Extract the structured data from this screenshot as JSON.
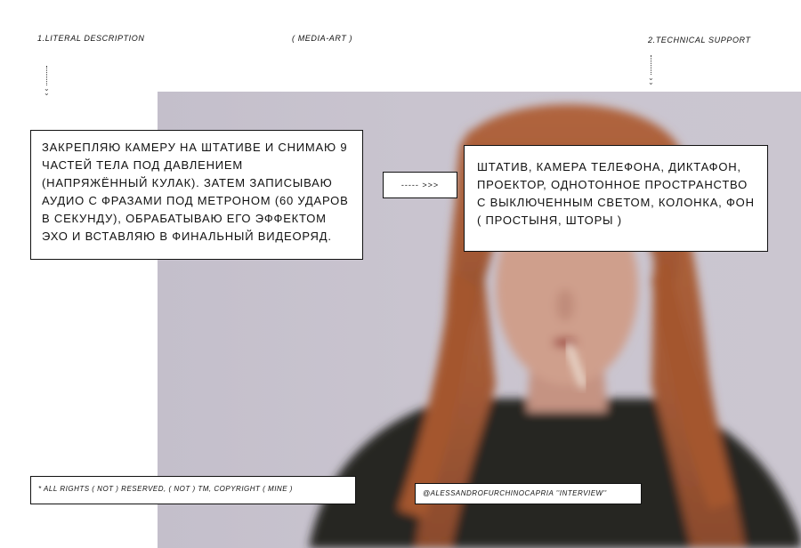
{
  "header": {
    "left_label": "1.LITERAL DESCRIPTION",
    "middle_label": "( MEDIA-ART )",
    "right_label": "2.TECHNICAL SUPPORT"
  },
  "description_box": {
    "text": "ЗАКРЕПЛЯЮ КАМЕРУ НА ШТАТИВЕ И СНИМАЮ 9 ЧАСТЕЙ ТЕЛА ПОД ДАВЛЕНИЕМ (НАПРЯЖЁННЫЙ КУЛАК). ЗАТЕМ ЗАПИСЫВАЮ АУДИО С ФРАЗАМИ ПОД МЕТРОНОМ (60 УДАРОВ В СЕКУНДУ), ОБРАБАТЫВАЮ ЕГО ЭФФЕКТОМ ЭХО И ВСТАВЛЯЮ В ФИНАЛЬНЫЙ ВИДЕОРЯД."
  },
  "connector": {
    "text": "----- >>>"
  },
  "technical_box": {
    "text": "ШТАТИВ, КАМЕРА ТЕЛЕФОНА, ДИКТАФОН, ПРОЕКТОР, ОДНОТОННОЕ ПРОСТРАНСТВО С ВЫКЛЮЧЕННЫМ СВЕТОМ, КОЛОНКА, ФОН ( ПРОСТЫНЯ, ШТОРЫ )"
  },
  "footer": {
    "copyright": "* ALL RIGHTS ( NOT ) RESERVED, ( NOT ) TM, COPYRIGHT ( MINE )",
    "credit": "@ALESSANDROFURCHINOCAPRIA ''INTERVIEW''"
  },
  "colors": {
    "photo_background": "#c9c4cf",
    "hair": "#a45a36",
    "sweater": "#262523",
    "skin": "#cf9f8c",
    "box_border": "#111111"
  },
  "icons": {
    "down_arrow": "dashed-down-arrow-icon"
  }
}
